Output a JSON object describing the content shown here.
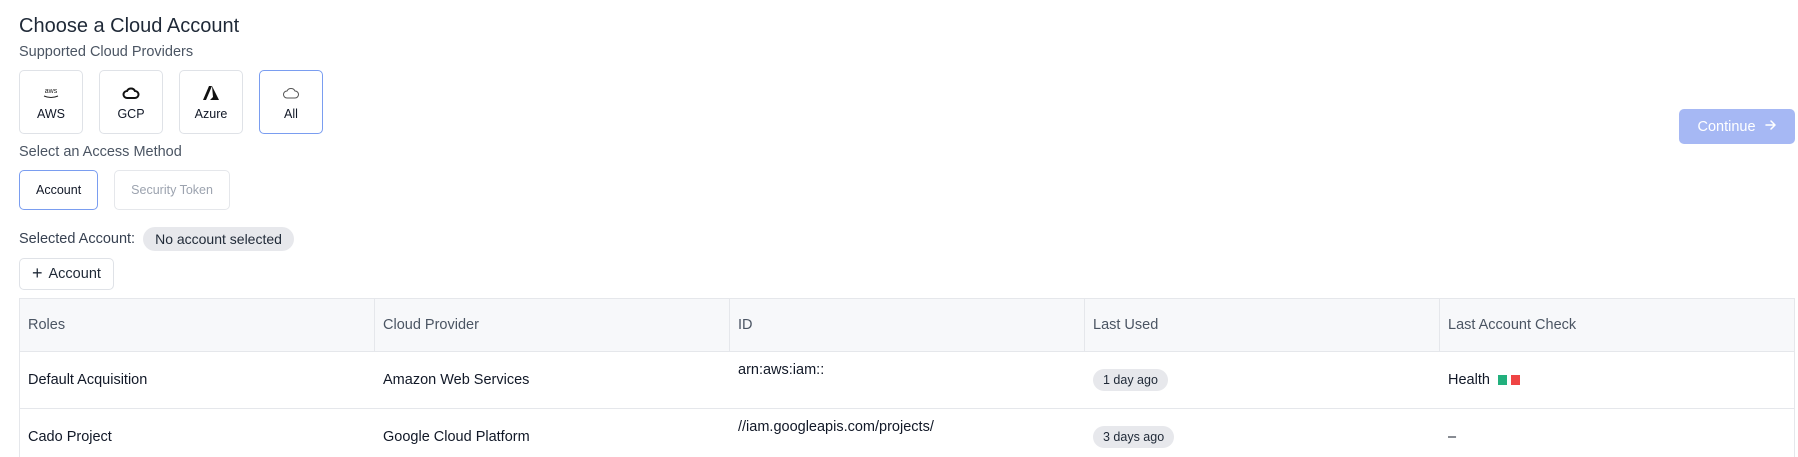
{
  "page": {
    "title": "Choose a Cloud Account",
    "providers_label": "Supported Cloud Providers",
    "method_label": "Select an Access Method",
    "selected_account_label": "Selected Account:",
    "selected_account_value": "No account selected",
    "add_account_label": "Account",
    "continue_label": "Continue"
  },
  "providers": [
    {
      "label": "AWS",
      "icon": "aws-icon",
      "selected": false
    },
    {
      "label": "GCP",
      "icon": "gcp-icon",
      "selected": false
    },
    {
      "label": "Azure",
      "icon": "azure-icon",
      "selected": false
    },
    {
      "label": "All",
      "icon": "cloud-icon",
      "selected": true
    }
  ],
  "methods": [
    {
      "label": "Account",
      "selected": true
    },
    {
      "label": "Security Token",
      "selected": false
    }
  ],
  "table": {
    "headers": [
      "Roles",
      "Cloud Provider",
      "ID",
      "Last Used",
      "Last Account Check"
    ],
    "rows": [
      {
        "role": "Default Acquisition",
        "provider": "Amazon Web Services",
        "id": "arn:aws:iam::",
        "last_used": "1 day ago",
        "check_label": "Health",
        "check_colors": [
          "#22b07d",
          "#ef4444"
        ]
      },
      {
        "role": "Cado Project",
        "provider": "Google Cloud Platform",
        "id": "//iam.googleapis.com/projects/",
        "last_used": "3 days ago",
        "check_label": "–"
      }
    ]
  },
  "colors": {
    "accent": "#7a9df0",
    "continue_bg": "#a6b8f4",
    "health_ok": "#22b07d",
    "health_bad": "#ef4444"
  }
}
